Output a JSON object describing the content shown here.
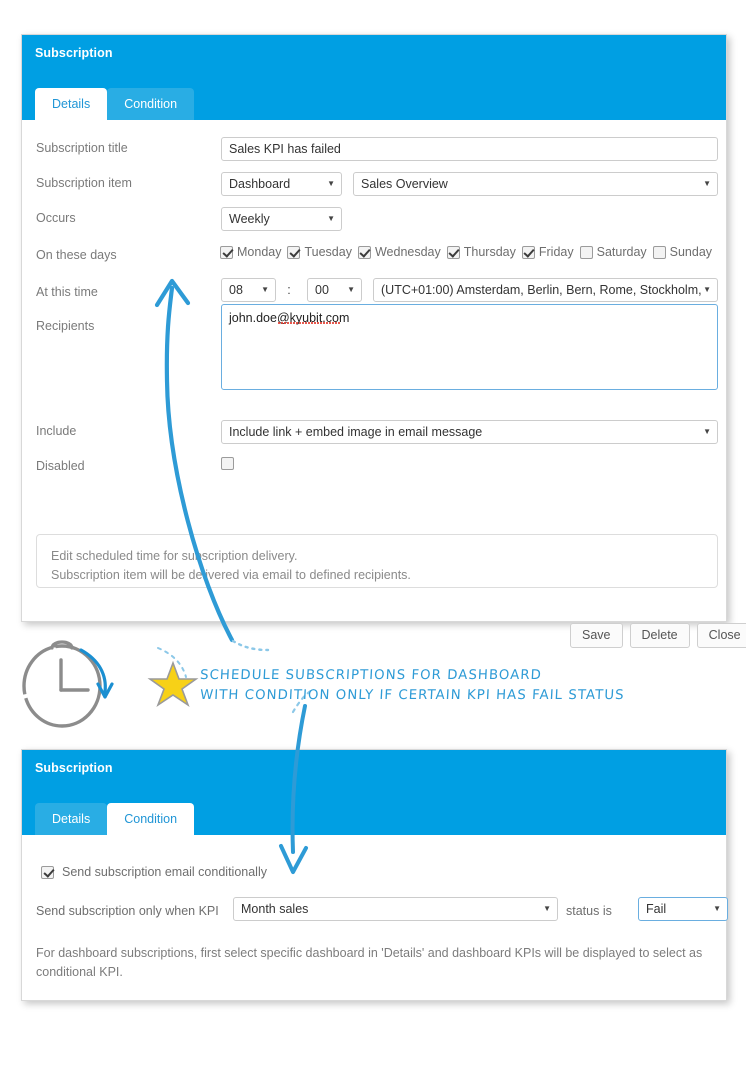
{
  "panel_details": {
    "title": "Subscription",
    "tabs": [
      {
        "label": "Details",
        "state": "active"
      },
      {
        "label": "Condition",
        "state": "inactive"
      }
    ],
    "fields": {
      "subscription_title": {
        "label": "Subscription title",
        "value": "Sales KPI has failed"
      },
      "subscription_item": {
        "label": "Subscription item",
        "type_value": "Dashboard",
        "item_value": "Sales Overview"
      },
      "occurs": {
        "label": "Occurs",
        "value": "Weekly"
      },
      "on_these_days": {
        "label": "On these days",
        "days": [
          {
            "label": "Monday",
            "checked": true
          },
          {
            "label": "Tuesday",
            "checked": true
          },
          {
            "label": "Wednesday",
            "checked": true
          },
          {
            "label": "Thursday",
            "checked": true
          },
          {
            "label": "Friday",
            "checked": true
          },
          {
            "label": "Saturday",
            "checked": false
          },
          {
            "label": "Sunday",
            "checked": false
          }
        ]
      },
      "at_this_time": {
        "label": "At this time",
        "hour": "08",
        "separator": ":",
        "minute": "00",
        "timezone": "(UTC+01:00) Amsterdam, Berlin, Bern, Rome, Stockholm,"
      },
      "recipients": {
        "label": "Recipients",
        "value": "john.doe@kyubit.com"
      },
      "include": {
        "label": "Include",
        "value": "Include link + embed image in email message"
      },
      "disabled": {
        "label": "Disabled",
        "checked": false
      }
    },
    "info_line1": "Edit scheduled time for subscription delivery.",
    "info_line2": "Subscription item will be delivered via email to defined recipients.",
    "buttons": {
      "save": "Save",
      "delete": "Delete",
      "close": "Close"
    }
  },
  "annotation": {
    "line1": "SCHEDULE SUBSCRIPTIONS FOR DASHBOARD",
    "line2": "WITH CONDITION ONLY IF CERTAIN KPI HAS FAIL STATUS",
    "star_icon": "star-icon",
    "clock_icon": "stopwatch-icon",
    "accent_color": "#2e9bd6",
    "star_color": "#f7d117",
    "clock_color": "#8c8c8c"
  },
  "panel_condition": {
    "title": "Subscription",
    "tabs": [
      {
        "label": "Details",
        "state": "inactive"
      },
      {
        "label": "Condition",
        "state": "active"
      }
    ],
    "conditional_checkbox": {
      "label": "Send subscription email conditionally",
      "checked": true
    },
    "kpi_row": {
      "prefix_label": "Send subscription only when KPI",
      "kpi_value": "Month sales",
      "middle_label": "status is",
      "status_value": "Fail"
    },
    "note_line1": "For dashboard subscriptions, first select specific dashboard in 'Details' and dashboard KPIs will be displayed to select as",
    "note_line2": "conditional KPI."
  },
  "theme": {
    "header_blue": "#009fe3",
    "tab_inactive_blue": "#29ade4",
    "tab_active_text": "#2196d6",
    "label_gray": "#7a7a7a"
  }
}
